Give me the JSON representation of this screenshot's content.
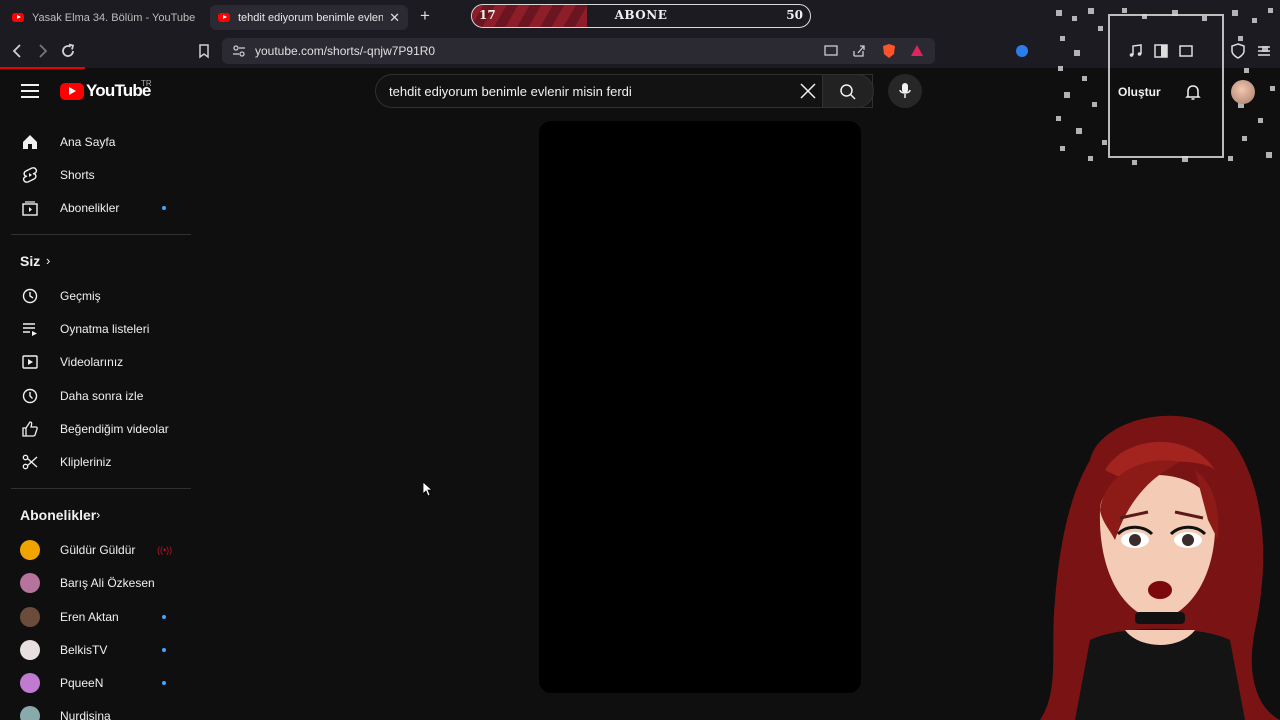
{
  "browser": {
    "tabs": [
      {
        "title": "Yasak Elma 34. Bölüm - YouTube"
      },
      {
        "title": "tehdit ediyorum benimle evlenir"
      }
    ],
    "url": "youtube.com/shorts/-qnjw7P91R0"
  },
  "subscriber_goal": {
    "current": "17",
    "label": "ABONE",
    "target": "50",
    "progress_fraction": 0.34
  },
  "header": {
    "logo_text": "YouTube",
    "region": "TR",
    "search_value": "tehdit ediyorum benimle evlenir misin ferdi",
    "create_label": "Oluştur"
  },
  "sidebar": {
    "main": [
      {
        "label": "Ana Sayfa",
        "icon": "home-icon"
      },
      {
        "label": "Shorts",
        "icon": "shorts-icon"
      },
      {
        "label": "Abonelikler",
        "icon": "subscriptions-icon",
        "new": true
      }
    ],
    "you_title": "Siz",
    "you": [
      {
        "label": "Geçmiş",
        "icon": "history-icon"
      },
      {
        "label": "Oynatma listeleri",
        "icon": "playlists-icon"
      },
      {
        "label": "Videolarınız",
        "icon": "your-videos-icon"
      },
      {
        "label": "Daha sonra izle",
        "icon": "watch-later-icon"
      },
      {
        "label": "Beğendiğim videolar",
        "icon": "liked-videos-icon"
      },
      {
        "label": "Klipleriniz",
        "icon": "clips-icon"
      }
    ],
    "subs_title": "Abonelikler",
    "channels": [
      {
        "name": "Güldür Güldür",
        "status": "live",
        "color": "#f0a400"
      },
      {
        "name": "Barış Ali Özkesen",
        "status": "",
        "color": "#b5739d"
      },
      {
        "name": "Eren Aktan",
        "status": "new",
        "color": "#6a4b3c"
      },
      {
        "name": "BelkisTV",
        "status": "new",
        "color": "#e8e0e0"
      },
      {
        "name": "PqueeN",
        "status": "new",
        "color": "#c07bd0"
      },
      {
        "name": "Nurdisina",
        "status": "",
        "color": "#8aa"
      }
    ]
  },
  "colors": {
    "accent": "#ff0000",
    "new_dot": "#3ea6ff",
    "live": "#c0132a"
  }
}
